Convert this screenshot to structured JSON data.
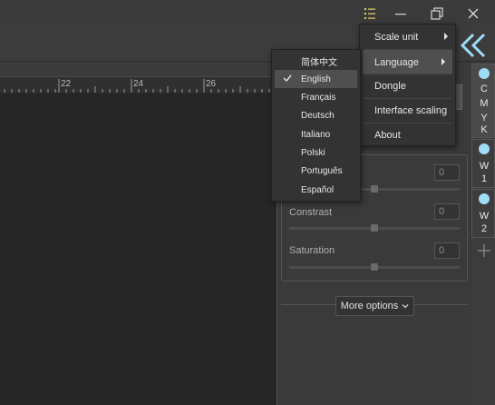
{
  "titlebar": {
    "menu_icon": "list-menu-icon",
    "minimize_icon": "minimize-icon",
    "maximize_icon": "restore-icon",
    "close_icon": "close-icon"
  },
  "toolbar": {
    "collapse_icon": "double-chevron-left-icon"
  },
  "ruler": {
    "labels": [
      "22",
      "24",
      "26"
    ]
  },
  "main_menu": {
    "items": [
      {
        "label": "Scale unit",
        "submenu": true
      },
      {
        "label": "Language",
        "submenu": true,
        "highlighted": true
      },
      {
        "label": "Dongle"
      },
      {
        "label": "Interface scaling"
      },
      {
        "label": "About"
      }
    ]
  },
  "language_menu": {
    "items": [
      "简体中文",
      "English",
      "Français",
      "Deutsch",
      "Italiano",
      "Polski",
      "Português",
      "Español"
    ],
    "selected": "English"
  },
  "adjustments": {
    "contrast_label": "Constrast",
    "saturation_label": "Saturation",
    "values": [
      "0",
      "0",
      "0"
    ]
  },
  "more_options": {
    "label": "More options",
    "icon": "chevron-down-icon"
  },
  "channels": [
    {
      "letters": [
        "C",
        "M",
        "Y",
        "K"
      ],
      "active": true
    },
    {
      "letters": [
        "W",
        "1"
      ],
      "active": false
    },
    {
      "letters": [
        "W",
        "2"
      ],
      "active": false
    }
  ],
  "colors": {
    "accent": "#9fdcf5",
    "menu_bg": "#333333",
    "highlight": "#4f4f4f"
  }
}
